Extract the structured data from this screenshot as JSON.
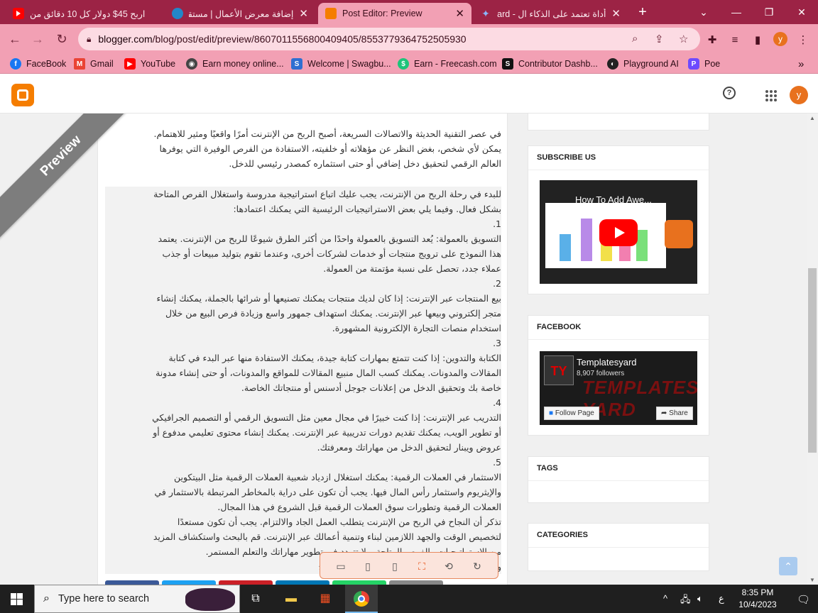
{
  "browser": {
    "tabs": [
      {
        "title": "اربح 45$ دولار كل 10 دقائق من",
        "favicon": "youtube-icon"
      },
      {
        "title": "إضافة معرض الأعمال | مستقل",
        "favicon": "mostaql-icon"
      },
      {
        "title": "Post Editor: Preview",
        "favicon": "blogger-icon",
        "active": true
      },
      {
        "title": "أداة تعتمد على الذكاء ال - Bard",
        "favicon": "bard-icon"
      }
    ],
    "new_tab": "+",
    "window_controls": {
      "dropdown": "⌄",
      "minimize": "—",
      "restore": "❐",
      "close": "✕"
    },
    "url_host": "blogger.com",
    "url_path": "/blog/post/edit/preview/8607011556800409405/8553779364752505930",
    "profile_initial": "y",
    "bookmarks": [
      {
        "label": "FaceBook",
        "icon": "facebook-icon",
        "color": "#1877f2"
      },
      {
        "label": "Gmail",
        "icon": "gmail-icon",
        "color": "#ea4335"
      },
      {
        "label": "YouTube",
        "icon": "youtube-icon",
        "color": "#ff0000"
      },
      {
        "label": "Earn money online...",
        "icon": "globe-icon",
        "color": "#555555"
      },
      {
        "label": "Welcome | Swagbu...",
        "icon": "swagbucks-icon",
        "color": "#2f6fd1"
      },
      {
        "label": "Earn - Freecash.com",
        "icon": "freecash-icon",
        "color": "#1ec47a"
      },
      {
        "label": "Contributor Dashb...",
        "icon": "contributor-icon",
        "color": "#111111"
      },
      {
        "label": "Playground AI",
        "icon": "playground-icon",
        "color": "#222222"
      },
      {
        "label": "Poe",
        "icon": "poe-icon",
        "color": "#6d4aff"
      }
    ],
    "bookmarks_more": "»"
  },
  "blogger": {
    "avatar_initial": "y",
    "help": "?"
  },
  "preview": {
    "ribbon": "Preview",
    "intro": [
      "في عصر التقنية الحديثة والاتصالات السريعة، أصبح الربح من الإنترنت أمرًا واقعيًا ومثير للاهتمام.",
      "يمكن لأي شخص، بغض النظر عن مؤهلاته أو خلفيته، الاستفادة من الفرص الوفيرة التي يوفرها",
      "العالم الرقمي لتحقيق دخل إضافي أو حتى استثماره كمصدر رئيسي للدخل."
    ],
    "body": [
      "للبدء في رحلة الربح من الإنترنت، يجب عليك اتباع استراتيجية مدروسة واستغلال الفرص المتاحة",
      "بشكل فعال. وفيما يلي بعض الاستراتيجيات الرئيسية التي يمكنك اعتمادها:",
      "1.",
      "التسويق بالعمولة: يُعد التسويق بالعمولة واحدًا من أكثر الطرق شيوعًا للربح من الإنترنت. يعتمد",
      "هذا النموذج على ترويج منتجات أو خدمات لشركات أخرى، وعندما تقوم بتوليد مبيعات أو جذب",
      "عملاء جدد، تحصل على نسبة مؤتمتة من العمولة.",
      "2.",
      "بيع المنتجات عبر الإنترنت: إذا كان لديك منتجات يمكنك تصنيعها أو شرائها بالجملة، يمكنك إنشاء",
      "متجر إلكتروني وبيعها عبر الإنترنت. يمكنك استهداف جمهور واسع وزيادة فرص البيع من خلال",
      "استخدام منصات التجارة الإلكترونية المشهورة.",
      "3.",
      "الكتابة والتدوين: إذا كنت تتمتع بمهارات كتابة جيدة، يمكنك الاستفادة منها عبر البدء في كتابة",
      "المقالات والمدونات. يمكنك كسب المال منبيع المقالات للمواقع والمدونات، أو حتى إنشاء مدونة",
      "خاصة بك وتحقيق الدخل من إعلانات جوجل أدسنس أو منتجاتك الخاصة.",
      "4.",
      "التدريب عبر الإنترنت: إذا كنت خبيرًا في مجال معين مثل التسويق الرقمي أو التصميم الجرافيكي",
      "أو تطوير الويب، يمكنك تقديم دورات تدريبية عبر الإنترنت. يمكنك إنشاء محتوى تعليمي مدفوع أو",
      "عروض ويبنار لتحقيق الدخل من مهاراتك ومعرفتك.",
      "5.",
      "الاستثمار في العملات الرقمية: يمكنك استغلال ازدياد شعبية العملات الرقمية مثل البيتكوين",
      "والإيثريوم واستثمار رأس المال فيها. يجب أن تكون على دراية بالمخاطر المرتبطة بالاستثمار في",
      "العملات الرقمية وتطورات سوق العملات الرقمية قبل الشروع في هذا المجال.",
      "تذكر أن النجاح في الربح من الإنترنت يتطلب العمل الجاد والالتزام. يجب أن تكون مستعدًا",
      "لتخصيص الوقت والجهد اللازمين لبناء وتنمية أعمالك عبر الإنترنت. قم بالبحث واستكشاف المزيد",
      "من الاستراتيجيات والفرص المتاحة، ولا تتردد في تطوير مهاراتك والتعلم المستمر.",
      "وتذكر أن الصبر والاستمرارية هما المفتاحان للنجاح"
    ],
    "sidebar": {
      "subscribe_title": "SUBSCRIBE US",
      "video_title": "How To Add Awe...",
      "facebook_title": "FACEBOOK",
      "fb_page_name": "Templatesyard",
      "fb_followers": "8,907 followers",
      "fb_banner": "TEMPLATES YARD",
      "fb_follow": "Follow Page",
      "fb_share": "Share",
      "tags_title": "TAGS",
      "categories_title": "CATEGORIES"
    },
    "back_to_top": "⌃"
  },
  "taskbar": {
    "search_placeholder": "Type here to search",
    "time": "8:35 PM",
    "date": "10/4/2023",
    "lang": "ع",
    "tray_up": "^"
  }
}
